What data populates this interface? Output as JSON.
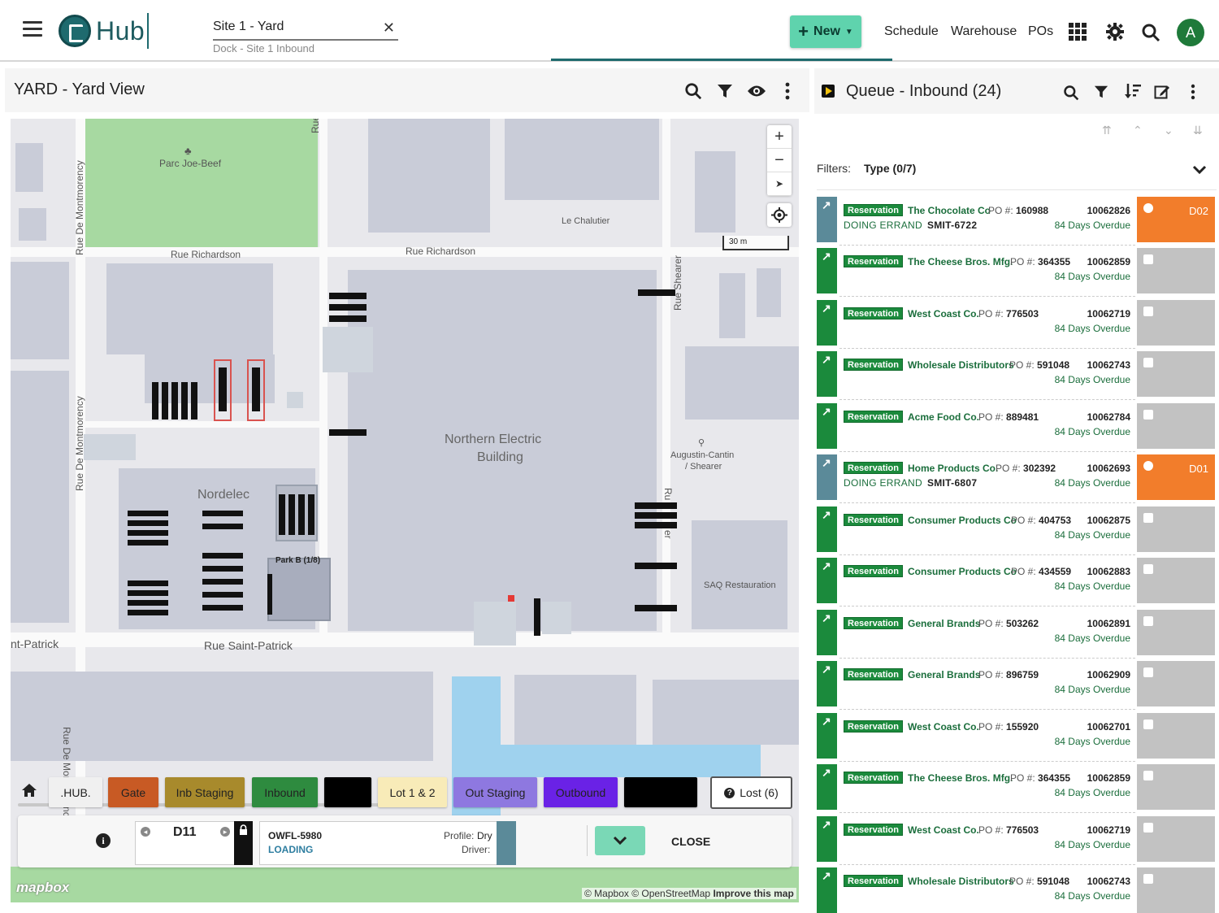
{
  "header": {
    "brand": "Hub",
    "site": "Site 1 - Yard",
    "site_sub": "Dock - Site 1 Inbound",
    "new_label": "New",
    "nav": [
      "Schedule",
      "Warehouse",
      "POs"
    ],
    "avatar_initial": "A",
    "colors": {
      "new_button": "#5fd3ad",
      "brand": "#1e6a6e",
      "avatar": "#1f7a3a"
    }
  },
  "yard": {
    "title": "YARD - Yard View",
    "map_labels": {
      "parc": "Parc Joe-Beef",
      "rue_de": "Rue de",
      "rue_montmorency_1": "Rue De Montmorency",
      "rue_montmorency_2": "Rue De Montmorency",
      "rue_montmorency_3": "Rue De Montmorency",
      "le_chalutier": "Le Chalutier",
      "rue_richardson_1": "Rue Richardson",
      "rue_richardson_2": "Rue Richardson",
      "rue_shearer": "Rue Shearer",
      "northern_1": "Northern Electric",
      "northern_2": "Building",
      "augustin_1": "Augustin-Cantin",
      "augustin_2": "/ Shearer",
      "nordelec": "Nordelec",
      "park_b": "Park B (1/8)",
      "saq": "SAQ Restauration",
      "saint_patrick": "Rue Saint-Patrick",
      "nt_patrick": "nt-Patrick",
      "rue_sh": "Ru",
      "rue_her": "er"
    },
    "scale_label": "30 m",
    "tabs": [
      {
        "label": ".HUB.",
        "bg": "#f0f0f0",
        "fg": "#222"
      },
      {
        "label": "Gate",
        "bg": "#c85a24",
        "fg": "#222"
      },
      {
        "label": "Inb Staging",
        "bg": "#a88a2c",
        "fg": "#222"
      },
      {
        "label": "Inbound",
        "bg": "#2e8b3f",
        "fg": "#222"
      },
      {
        "label": "",
        "bg": "#000000",
        "fg": "#fff"
      },
      {
        "label": "Lot 1 & 2",
        "bg": "#f8ebb8",
        "fg": "#222"
      },
      {
        "label": "Out Staging",
        "bg": "#8e78e0",
        "fg": "#222"
      },
      {
        "label": "Outbound",
        "bg": "#6a22e6",
        "fg": "#222"
      },
      {
        "label": "",
        "bg": "#000000",
        "fg": "#fff"
      }
    ],
    "lost_label": "Lost (6)",
    "card": {
      "door": "D11",
      "trailer": "OWFL-5980",
      "status": "LOADING",
      "profile_label": "Profile:",
      "profile_value": "Dry",
      "driver_label": "Driver:",
      "close_label": "CLOSE"
    },
    "mapbox": "mapbox",
    "attribution": "© Mapbox © OpenStreetMap",
    "improve": "Improve this map"
  },
  "queue": {
    "title": "Queue - Inbound (24)",
    "filters_label": "Filters:",
    "filters_value": "Type (0/7)",
    "po_label": "PO #:",
    "items": [
      {
        "badge": "Reservation",
        "company": "The Chocolate Co",
        "po": "160988",
        "id": "10062826",
        "overdue": "84 Days Overdue",
        "errand": "DOING ERRAND",
        "truck": "SMIT-6722",
        "door": "D02",
        "active": true
      },
      {
        "badge": "Reservation",
        "company": "The Cheese Bros. Mfg.",
        "po": "364355",
        "id": "10062859",
        "overdue": "84 Days Overdue",
        "errand": "",
        "truck": "",
        "door": "",
        "active": false
      },
      {
        "badge": "Reservation",
        "company": "West Coast Co.",
        "po": "776503",
        "id": "10062719",
        "overdue": "84 Days Overdue",
        "errand": "",
        "truck": "",
        "door": "",
        "active": false
      },
      {
        "badge": "Reservation",
        "company": "Wholesale Distributors",
        "po": "591048",
        "id": "10062743",
        "overdue": "84 Days Overdue",
        "errand": "",
        "truck": "",
        "door": "",
        "active": false
      },
      {
        "badge": "Reservation",
        "company": "Acme Food Co.",
        "po": "889481",
        "id": "10062784",
        "overdue": "84 Days Overdue",
        "errand": "",
        "truck": "",
        "door": "",
        "active": false
      },
      {
        "badge": "Reservation",
        "company": "Home Products Co.",
        "po": "302392",
        "id": "10062693",
        "overdue": "84 Days Overdue",
        "errand": "DOING ERRAND",
        "truck": "SMIT-6807",
        "door": "D01",
        "active": true
      },
      {
        "badge": "Reservation",
        "company": "Consumer Products Co",
        "po": "404753",
        "id": "10062875",
        "overdue": "84 Days Overdue",
        "errand": "",
        "truck": "",
        "door": "",
        "active": false
      },
      {
        "badge": "Reservation",
        "company": "Consumer Products Co",
        "po": "434559",
        "id": "10062883",
        "overdue": "84 Days Overdue",
        "errand": "",
        "truck": "",
        "door": "",
        "active": false
      },
      {
        "badge": "Reservation",
        "company": "General Brands",
        "po": "503262",
        "id": "10062891",
        "overdue": "84 Days Overdue",
        "errand": "",
        "truck": "",
        "door": "",
        "active": false
      },
      {
        "badge": "Reservation",
        "company": "General Brands",
        "po": "896759",
        "id": "10062909",
        "overdue": "84 Days Overdue",
        "errand": "",
        "truck": "",
        "door": "",
        "active": false
      },
      {
        "badge": "Reservation",
        "company": "West Coast Co.",
        "po": "155920",
        "id": "10062701",
        "overdue": "84 Days Overdue",
        "errand": "",
        "truck": "",
        "door": "",
        "active": false
      },
      {
        "badge": "Reservation",
        "company": "The Cheese Bros. Mfg.",
        "po": "364355",
        "id": "10062859",
        "overdue": "84 Days Overdue",
        "errand": "",
        "truck": "",
        "door": "",
        "active": false
      },
      {
        "badge": "Reservation",
        "company": "West Coast Co.",
        "po": "776503",
        "id": "10062719",
        "overdue": "84 Days Overdue",
        "errand": "",
        "truck": "",
        "door": "",
        "active": false
      },
      {
        "badge": "Reservation",
        "company": "Wholesale Distributors",
        "po": "591048",
        "id": "10062743",
        "overdue": "84 Days Overdue",
        "errand": "",
        "truck": "",
        "door": "",
        "active": false
      }
    ],
    "colors": {
      "active_strip": "#5b8a99",
      "idle_strip": "#1b8a3c",
      "active_door": "#f27d2b",
      "idle_door": "#c2c2c2"
    }
  }
}
